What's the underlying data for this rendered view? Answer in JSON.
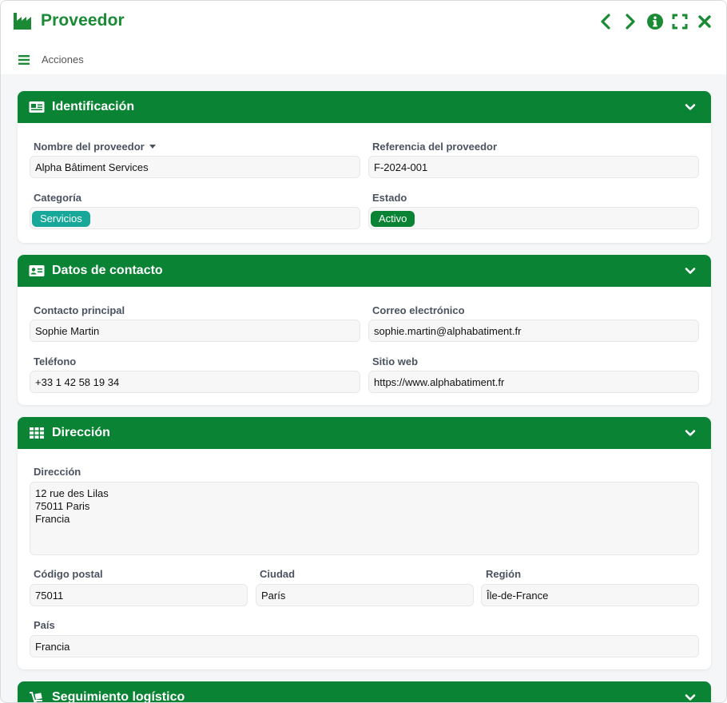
{
  "header": {
    "title": "Proveedor",
    "actions_label": "Acciones",
    "brand_color": "#1b8a35",
    "icons": [
      "factory-icon",
      "chevron-left-icon",
      "chevron-right-icon",
      "info-icon",
      "fullscreen-icon",
      "close-icon",
      "menu-icon"
    ]
  },
  "sections": {
    "identificacion": {
      "title": "Identificación",
      "nombre_label": "Nombre del proveedor",
      "nombre_value": "Alpha Bâtiment Services",
      "referencia_label": "Referencia del proveedor",
      "referencia_value": "F-2024-001",
      "categoria_label": "Categoría",
      "categoria_tag": "Servicios",
      "categoria_tag_color": "#17a89a",
      "estado_label": "Estado",
      "estado_tag": "Activo",
      "estado_tag_color": "#0a8434"
    },
    "contacto": {
      "title": "Datos de contacto",
      "contacto_label": "Contacto principal",
      "contacto_value": "Sophie Martin",
      "correo_label": "Correo electrónico",
      "correo_value": "sophie.martin@alphabatiment.fr",
      "telefono_label": "Teléfono",
      "telefono_value": "+33 1 42 58 19 34",
      "web_label": "Sitio web",
      "web_value": "https://www.alphabatiment.fr"
    },
    "direccion": {
      "title": "Dirección",
      "direccion_label": "Dirección",
      "direccion_value": "12 rue des Lilas\n75011 Paris\nFrancia",
      "cp_label": "Código postal",
      "cp_value": "75011",
      "ciudad_label": "Ciudad",
      "ciudad_value": "París",
      "region_label": "Región",
      "region_value": "Île-de-France",
      "pais_label": "País",
      "pais_value": "Francia"
    },
    "logistica": {
      "title": "Seguimiento logístico"
    }
  },
  "colors": {
    "section_header": "#0a8434",
    "background": "#f4f6f7"
  }
}
